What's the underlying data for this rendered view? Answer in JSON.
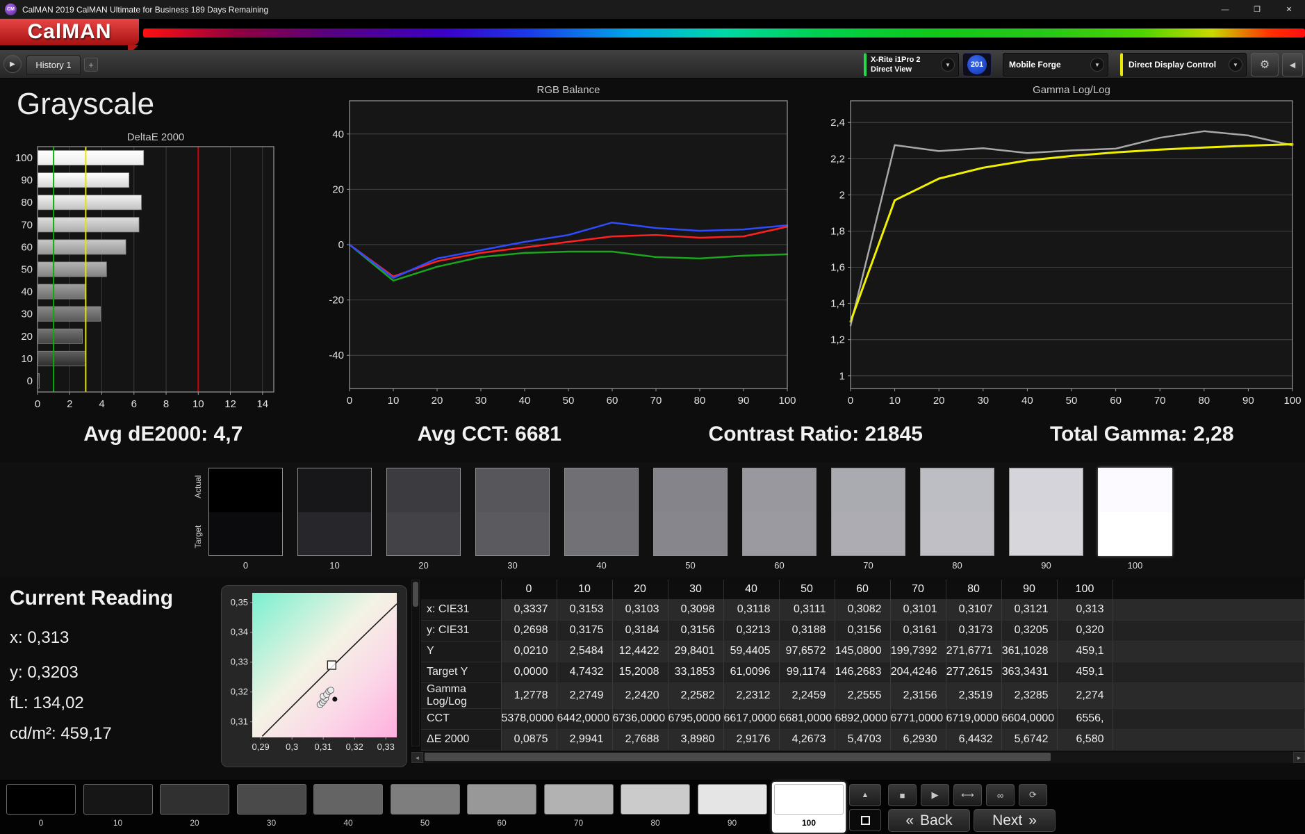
{
  "window": {
    "title": "CalMAN 2019 CalMAN Ultimate for Business 189 Days Remaining",
    "app_badge": "CM"
  },
  "logo": {
    "text": "CalMAN"
  },
  "tab_bar": {
    "tabs": [
      {
        "label": "History 1"
      }
    ],
    "add_tab": "+"
  },
  "toolbar": {
    "meter": {
      "line1": "X-Rite i1Pro 2",
      "line2": "Direct View",
      "badge": "201",
      "accent": "#27d84a"
    },
    "source": {
      "label": "Mobile Forge"
    },
    "display_control": {
      "label": "Direct Display Control",
      "accent": "#e8e800"
    }
  },
  "page": {
    "title": "Grayscale"
  },
  "stats": [
    "Avg dE2000: 4,7",
    "Avg CCT: 6681",
    "Contrast Ratio: 21845",
    "Total Gamma: 2,28"
  ],
  "chart_data": [
    {
      "name": "delta_e_2000",
      "type": "bar",
      "title": "DeltaE 2000",
      "orientation": "horizontal",
      "categories": [
        "100",
        "90",
        "80",
        "70",
        "60",
        "50",
        "40",
        "30",
        "20",
        "10",
        "0"
      ],
      "values": [
        6.58,
        5.67,
        6.44,
        6.29,
        5.47,
        4.27,
        2.92,
        3.9,
        2.77,
        2.99,
        0.09
      ],
      "xlim": [
        0,
        14.7
      ],
      "xticks": [
        0,
        2,
        4,
        6,
        8,
        10,
        12,
        14
      ],
      "reference_lines": [
        {
          "value": 1,
          "color": "#00b400",
          "name": "good-threshold"
        },
        {
          "value": 3,
          "color": "#e6e600",
          "name": "warning-threshold"
        },
        {
          "value": 10,
          "color": "#d40000",
          "name": "bad-threshold"
        }
      ]
    },
    {
      "name": "rgb_balance",
      "type": "line",
      "title": "RGB Balance",
      "x": [
        0,
        10,
        20,
        30,
        40,
        50,
        60,
        70,
        80,
        90,
        100
      ],
      "xticks": [
        0,
        10,
        20,
        30,
        40,
        50,
        60,
        70,
        80,
        90,
        100
      ],
      "ylim": [
        -52,
        52
      ],
      "yticks": [
        {
          "v": 40,
          "label": "40"
        },
        {
          "v": 20,
          "label": "20"
        },
        {
          "v": 0,
          "label": "0"
        },
        {
          "v": -20,
          "label": "-20"
        },
        {
          "v": -40,
          "label": "-40"
        }
      ],
      "series": [
        {
          "name": "green",
          "color": "#1ea51e",
          "width": 2.5,
          "values": [
            0,
            -13,
            -8,
            -4.5,
            -3,
            -2.5,
            -2.5,
            -4.5,
            -5,
            -4,
            -3.5
          ]
        },
        {
          "name": "red",
          "color": "#ff2020",
          "width": 2.5,
          "values": [
            0,
            -11.5,
            -6,
            -3,
            -1,
            1,
            3,
            3.5,
            2.5,
            3,
            6.5
          ]
        },
        {
          "name": "blue",
          "color": "#2e4bff",
          "width": 2.5,
          "values": [
            0,
            -12,
            -5,
            -2,
            1,
            3.5,
            8,
            6,
            5,
            5.5,
            7
          ]
        }
      ]
    },
    {
      "name": "gamma_log_log",
      "type": "line",
      "title": "Gamma Log/Log",
      "x": [
        0,
        10,
        20,
        30,
        40,
        50,
        60,
        70,
        80,
        90,
        100
      ],
      "xticks": [
        0,
        10,
        20,
        30,
        40,
        50,
        60,
        70,
        80,
        90,
        100
      ],
      "ylim": [
        0.93,
        2.52
      ],
      "yticks": [
        {
          "v": 2.4,
          "label": "2,4"
        },
        {
          "v": 2.2,
          "label": "2,2"
        },
        {
          "v": 2.0,
          "label": "2"
        },
        {
          "v": 1.8,
          "label": "1,8"
        },
        {
          "v": 1.6,
          "label": "1,6"
        },
        {
          "v": 1.4,
          "label": "1,4"
        },
        {
          "v": 1.2,
          "label": "1,2"
        },
        {
          "v": 1.0,
          "label": "1"
        }
      ],
      "series": [
        {
          "name": "measured",
          "color": "#a8a8a8",
          "width": 2.5,
          "values": [
            1.2778,
            2.2749,
            2.242,
            2.2582,
            2.2312,
            2.2459,
            2.2555,
            2.3156,
            2.3519,
            2.3285,
            2.274
          ]
        },
        {
          "name": "target",
          "color": "#f0f000",
          "width": 3,
          "values": [
            1.3,
            1.97,
            2.09,
            2.15,
            2.19,
            2.215,
            2.235,
            2.25,
            2.262,
            2.272,
            2.28
          ]
        }
      ]
    },
    {
      "name": "cie_chromaticity",
      "type": "scatter",
      "xlim": [
        0.2873,
        0.3335
      ],
      "ylim": [
        0.3048,
        0.3532
      ],
      "xticks": [
        {
          "v": 0.29,
          "label": "0,29"
        },
        {
          "v": 0.3,
          "label": "0,3"
        },
        {
          "v": 0.31,
          "label": "0,31"
        },
        {
          "v": 0.32,
          "label": "0,32"
        },
        {
          "v": 0.33,
          "label": "0,33"
        }
      ],
      "yticks": [
        {
          "v": 0.35,
          "label": "0,35"
        },
        {
          "v": 0.34,
          "label": "0,34"
        },
        {
          "v": 0.33,
          "label": "0,33"
        },
        {
          "v": 0.32,
          "label": "0,32"
        },
        {
          "v": 0.31,
          "label": "0,31"
        }
      ],
      "locus": {
        "start": [
          0.2905,
          0.3052
        ],
        "ctrl": [
          0.3175,
          0.3335
        ],
        "end": [
          0.3335,
          0.3495
        ]
      },
      "target_square": [
        0.3127,
        0.329
      ],
      "points": [
        {
          "x": 0.309,
          "y": 0.3158,
          "style": "open"
        },
        {
          "x": 0.3097,
          "y": 0.3165,
          "style": "open"
        },
        {
          "x": 0.3102,
          "y": 0.3172,
          "style": "open"
        },
        {
          "x": 0.3107,
          "y": 0.3179,
          "style": "open"
        },
        {
          "x": 0.31,
          "y": 0.3186,
          "style": "open"
        },
        {
          "x": 0.3111,
          "y": 0.3192,
          "style": "open"
        },
        {
          "x": 0.3118,
          "y": 0.3202,
          "style": "open"
        },
        {
          "x": 0.3124,
          "y": 0.3206,
          "style": "open"
        },
        {
          "x": 0.3137,
          "y": 0.3176,
          "style": "filled"
        }
      ]
    }
  ],
  "swatches": {
    "actual_label": "Actual",
    "target_label": "Target",
    "selected": "100",
    "levels": [
      {
        "label": "0",
        "actual": "#000000",
        "target": "#0b0b0d"
      },
      {
        "label": "10",
        "actual": "#17171a",
        "target": "#27272b"
      },
      {
        "label": "20",
        "actual": "#3c3c40",
        "target": "#424247"
      },
      {
        "label": "30",
        "actual": "#56565b",
        "target": "#5a5a5f"
      },
      {
        "label": "40",
        "actual": "#6f6f74",
        "target": "#717176"
      },
      {
        "label": "50",
        "actual": "#84848a",
        "target": "#86868c"
      },
      {
        "label": "60",
        "actual": "#98989e",
        "target": "#9a9aa0"
      },
      {
        "label": "70",
        "actual": "#aaaab1",
        "target": "#acacb2"
      },
      {
        "label": "80",
        "actual": "#bdbdc4",
        "target": "#bfbfc5"
      },
      {
        "label": "90",
        "actual": "#d4d4da",
        "target": "#d6d6db"
      },
      {
        "label": "100",
        "actual": "#fdfaff",
        "target": "#ffffff"
      }
    ]
  },
  "current_reading": {
    "title": "Current Reading",
    "lines": [
      "x: 0,313",
      "y: 0,3203",
      "fL: 134,02",
      "cd/m²: 459,17"
    ]
  },
  "table": {
    "columns": [
      "0",
      "10",
      "20",
      "30",
      "40",
      "50",
      "60",
      "70",
      "80",
      "90",
      "100"
    ],
    "rows": [
      {
        "label": "x: CIE31",
        "values": [
          "0,3337",
          "0,3153",
          "0,3103",
          "0,3098",
          "0,3118",
          "0,3111",
          "0,3082",
          "0,3101",
          "0,3107",
          "0,3121",
          "0,313"
        ]
      },
      {
        "label": "y: CIE31",
        "values": [
          "0,2698",
          "0,3175",
          "0,3184",
          "0,3156",
          "0,3213",
          "0,3188",
          "0,3156",
          "0,3161",
          "0,3173",
          "0,3205",
          "0,320"
        ]
      },
      {
        "label": "Y",
        "values": [
          "0,0210",
          "2,5484",
          "12,4422",
          "29,8401",
          "59,4405",
          "97,6572",
          "145,0800",
          "199,7392",
          "271,6771",
          "361,1028",
          "459,1"
        ]
      },
      {
        "label": "Target Y",
        "values": [
          "0,0000",
          "4,7432",
          "15,2008",
          "33,1853",
          "61,0096",
          "99,1174",
          "146,2683",
          "204,4246",
          "277,2615",
          "363,3431",
          "459,1"
        ]
      },
      {
        "label": "Gamma Log/Log",
        "values": [
          "1,2778",
          "2,2749",
          "2,2420",
          "2,2582",
          "2,2312",
          "2,2459",
          "2,2555",
          "2,3156",
          "2,3519",
          "2,3285",
          "2,274"
        ]
      },
      {
        "label": "CCT",
        "values": [
          "5378,0000",
          "6442,0000",
          "6736,0000",
          "6795,0000",
          "6617,0000",
          "6681,0000",
          "6892,0000",
          "6771,0000",
          "6719,0000",
          "6604,0000",
          "6556,"
        ]
      },
      {
        "label": "ΔE 2000",
        "values": [
          "0,0875",
          "2,9941",
          "2,7688",
          "3,8980",
          "2,9176",
          "4,2673",
          "5,4703",
          "6,2930",
          "6,4432",
          "5,6742",
          "6,580"
        ]
      }
    ]
  },
  "patch_bar": {
    "selected": "100",
    "levels": [
      {
        "label": "0",
        "color": "#000000"
      },
      {
        "label": "10",
        "color": "#161616"
      },
      {
        "label": "20",
        "color": "#303030"
      },
      {
        "label": "30",
        "color": "#4a4a4a"
      },
      {
        "label": "40",
        "color": "#646464"
      },
      {
        "label": "50",
        "color": "#7e7e7e"
      },
      {
        "label": "60",
        "color": "#989898"
      },
      {
        "label": "70",
        "color": "#b2b2b2"
      },
      {
        "label": "80",
        "color": "#cbcbcb"
      },
      {
        "label": "90",
        "color": "#e5e5e5"
      },
      {
        "label": "100",
        "color": "#ffffff"
      }
    ]
  },
  "nav": {
    "back_label": "Back",
    "next_label": "Next"
  },
  "icons": {
    "minimize": "—",
    "maximize": "❐",
    "close": "✕",
    "tab_scroll": "▶",
    "dropdown_caret": "▼",
    "gear": "⚙",
    "panel_collapse": "◀",
    "scroll_left": "◄",
    "scroll_right": "►",
    "patch_up": "▲",
    "stop": "■",
    "play": "▶",
    "measure_once": "⟷",
    "continuous": "∞",
    "refresh": "⟳",
    "back": "«",
    "next": "»"
  }
}
